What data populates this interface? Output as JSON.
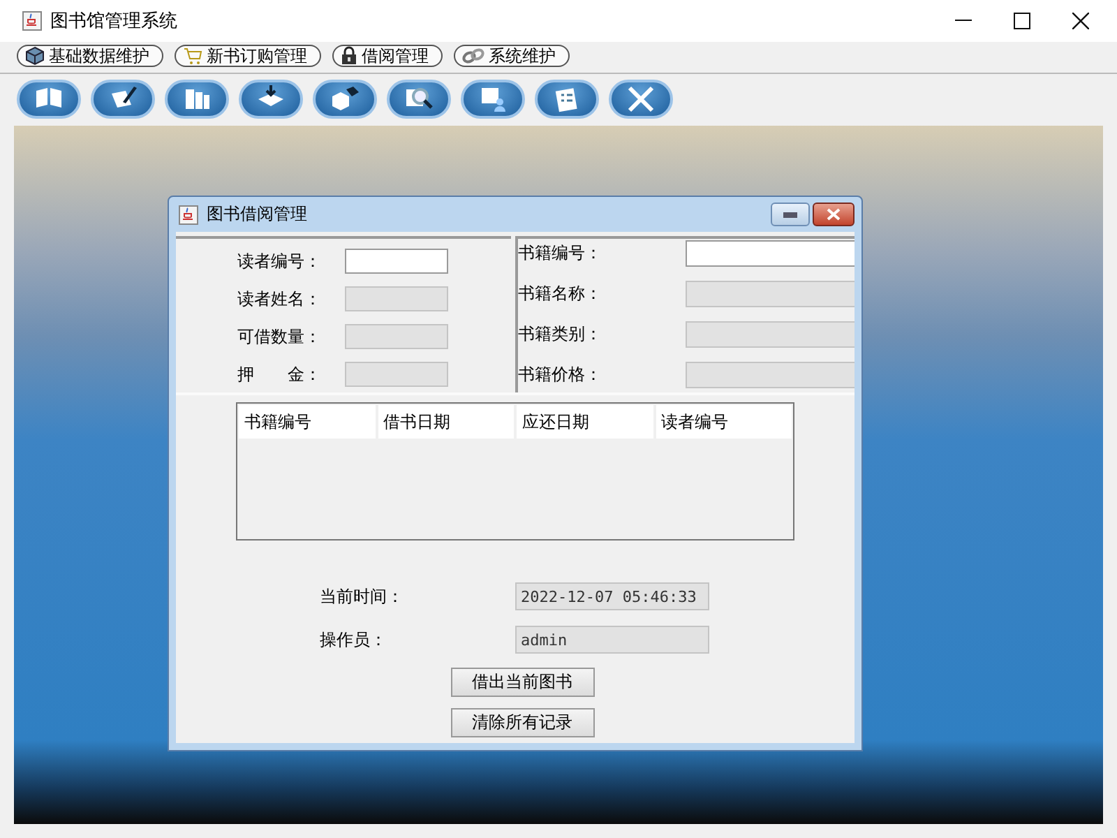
{
  "window": {
    "title": "图书馆管理系统"
  },
  "menu": [
    {
      "label": "基础数据维护"
    },
    {
      "label": "新书订购管理"
    },
    {
      "label": "借阅管理"
    },
    {
      "label": "系统维护"
    }
  ],
  "dialog": {
    "title": "图书借阅管理",
    "reader_fields": [
      {
        "label": "读者编号：",
        "disabled": false
      },
      {
        "label": "读者姓名：",
        "disabled": true
      },
      {
        "label": "可借数量：",
        "disabled": true
      },
      {
        "label": "押　　金：",
        "disabled": true
      }
    ],
    "book_fields": [
      {
        "label": "书籍编号：",
        "disabled": false
      },
      {
        "label": "书籍名称：",
        "disabled": true
      },
      {
        "label": "书籍类别：",
        "disabled": true
      },
      {
        "label": "书籍价格：",
        "disabled": true
      }
    ],
    "table": {
      "columns": [
        "书籍编号",
        "借书日期",
        "应还日期",
        "读者编号"
      ]
    },
    "info_fields": [
      {
        "label": "当前时间：",
        "value": "2022-12-07 05:46:33",
        "disabled": true
      },
      {
        "label": "操作员：",
        "value": "admin",
        "disabled": true
      }
    ],
    "buttons": [
      "借出当前图书",
      "清除所有记录"
    ]
  }
}
